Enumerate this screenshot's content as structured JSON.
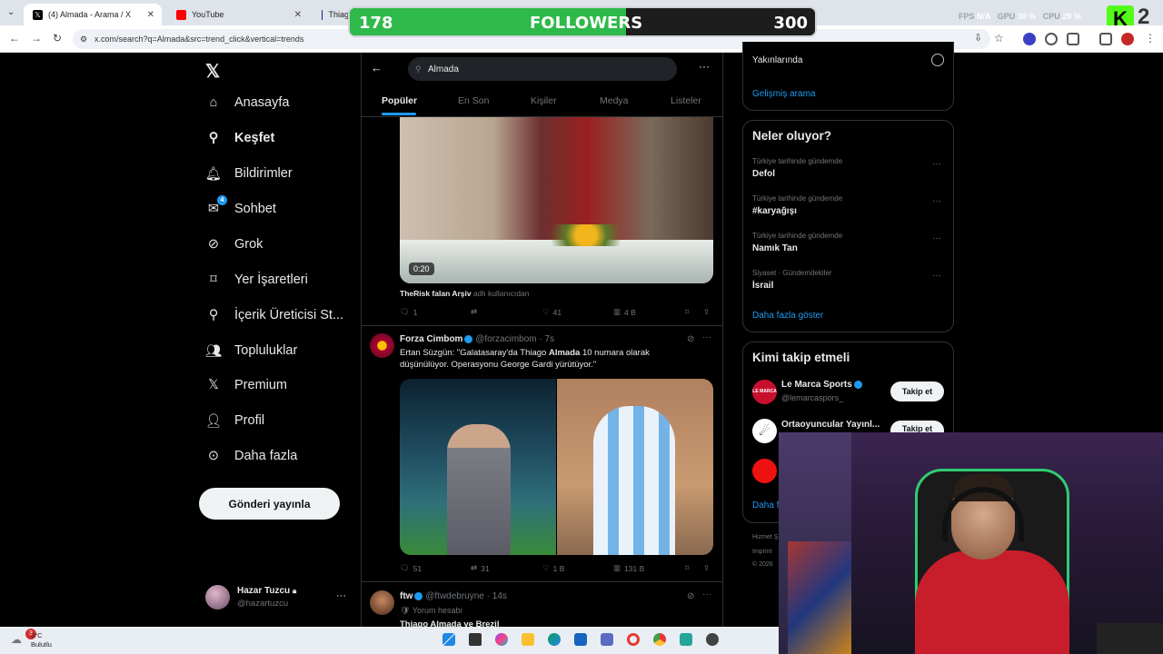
{
  "browser": {
    "tabs": [
      {
        "title": "(4) Almada - Arama / X",
        "active": true,
        "favicon": "x-logo-icon"
      },
      {
        "title": "YouTube",
        "active": false,
        "favicon": "youtube-icon"
      },
      {
        "title": "Thiag",
        "active": false,
        "favicon": "news-icon"
      }
    ],
    "url": "x.com/search?q=Almada&src=trend_click&vertical=trends",
    "perf": {
      "fps_label": "FPS",
      "fps_value": "N/A",
      "gpu_label": "GPU",
      "gpu_value": "30 %",
      "cpu_label": "CPU",
      "cpu_value": "29 %"
    }
  },
  "overlay": {
    "current": "178",
    "label": "FOLLOWERS",
    "goal": "300",
    "progress_fraction": 0.593,
    "badge_number": "2"
  },
  "sidebar": {
    "items": [
      {
        "label": "Anasayfa",
        "icon": "home-icon"
      },
      {
        "label": "Keşfet",
        "icon": "search-icon",
        "active": true
      },
      {
        "label": "Bildirimler",
        "icon": "bell-icon"
      },
      {
        "label": "Sohbet",
        "icon": "mail-icon",
        "badge": "4"
      },
      {
        "label": "Grok",
        "icon": "grok-icon"
      },
      {
        "label": "Yer İşaretleri",
        "icon": "bookmark-icon"
      },
      {
        "label": "İçerik Üreticisi St...",
        "icon": "creator-icon"
      },
      {
        "label": "Topluluklar",
        "icon": "communities-icon"
      },
      {
        "label": "Premium",
        "icon": "x-logo-icon"
      },
      {
        "label": "Profil",
        "icon": "person-icon"
      },
      {
        "label": "Daha fazla",
        "icon": "more-circle-icon"
      }
    ],
    "post_button": "Gönderi yayınla",
    "account": {
      "name": "Hazar Tuzcu",
      "handle": "@hazartuzcu"
    }
  },
  "search": {
    "query": "Almada",
    "tabs": [
      "Popüler",
      "En Son",
      "Kişiler",
      "Medya",
      "Listeler"
    ]
  },
  "tweets": [
    {
      "video_time": "0:20",
      "credit_name": "TheRisk falan Arşiv",
      "credit_suffix": "adlı kullanıcıdan",
      "replies": "1",
      "retweets": "",
      "likes": "41",
      "views": "4 B"
    },
    {
      "name": "Forza Cimbom",
      "handle": "@forzacimbom",
      "time": "· 7s",
      "text_before": "Ertan Süzgün: \"Galatasaray'da Thiago ",
      "text_bold": "Almada",
      "text_after": " 10 numara olarak düşünülüyor. Operasyonu George Gardi yürütüyor.\"",
      "replies": "51",
      "retweets": "31",
      "likes": "1 B",
      "views": "131 B"
    },
    {
      "name": "ftw",
      "handle": "@ftwdebruyne",
      "time": "· 14s",
      "subtext": "Yorum hesabı",
      "text_preview": "Thiago Almada ve Brezil"
    }
  ],
  "right": {
    "location_option": "Yakınlarında",
    "advanced_search": "Gelişmiş arama",
    "trends_title": "Neler oluyor?",
    "trends": [
      {
        "category": "Türkiye tarihinde gündemde",
        "name": "Defol"
      },
      {
        "category": "Türkiye tarihinde gündemde",
        "name": "#karyağışı"
      },
      {
        "category": "Türkiye tarihinde gündemde",
        "name": "Namık Tan"
      },
      {
        "category": "Siyaset · Gündemdekiler",
        "name": "İsrail"
      }
    ],
    "show_more": "Daha fazla göster",
    "who_to_follow_title": "Kimi takip etmeli",
    "suggestions": [
      {
        "name": "Le Marca Sports",
        "handle": "@lemarcaspors_",
        "button": "Takip et"
      },
      {
        "name": "Ortaoyuncular Yayınl...",
        "handle": "",
        "button": "Takip et"
      }
    ],
    "show_more_cut": "Daha f",
    "footer": [
      "Hizmet Ş",
      "Imprint",
      "© 2026"
    ]
  },
  "taskbar": {
    "weather_temp": "3°C",
    "weather_text": "Bulutlu",
    "weather_badge": "3"
  },
  "colors": {
    "accent": "#1d9bf0",
    "background": "#000000",
    "progress_fill": "#2fb94a"
  }
}
